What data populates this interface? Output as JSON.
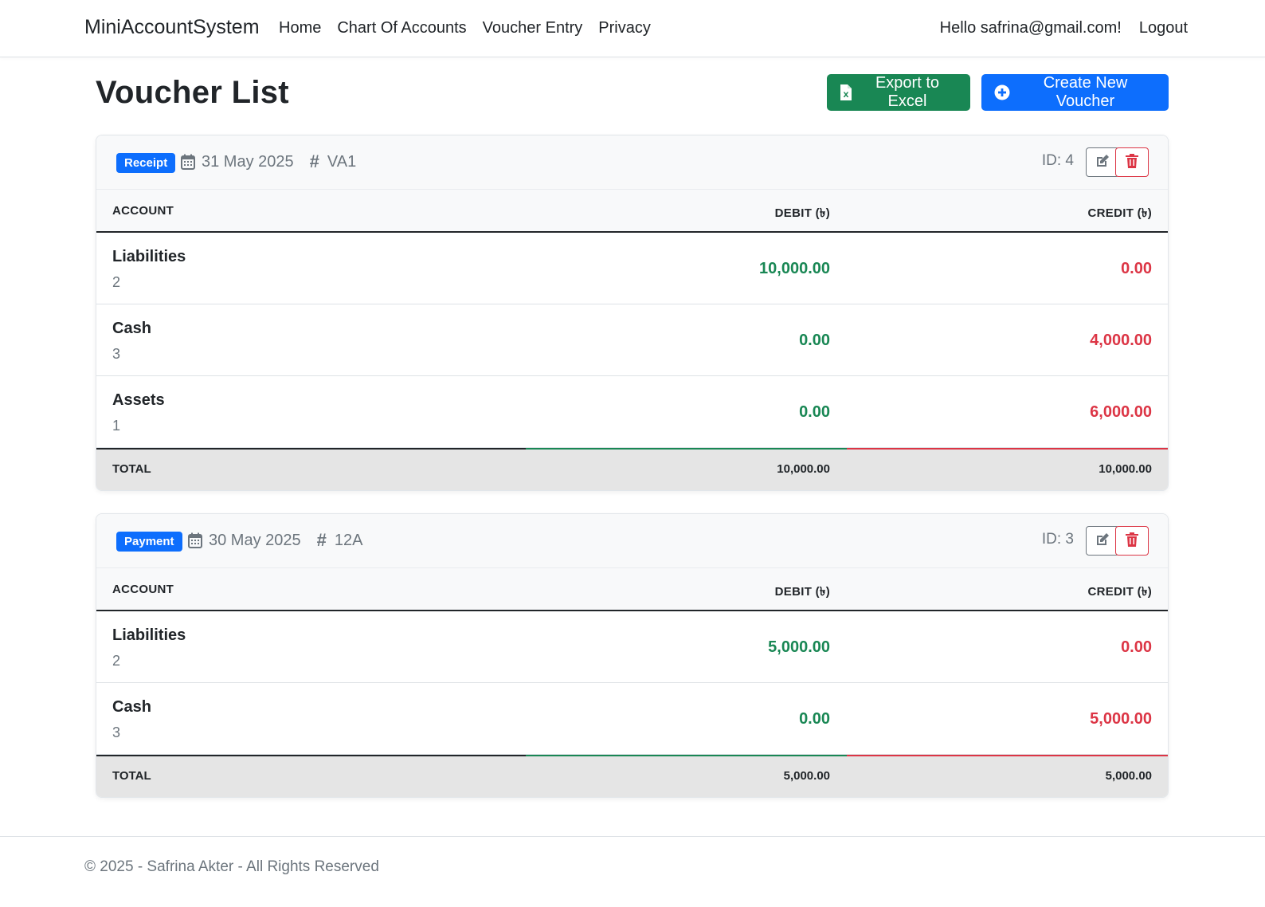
{
  "navbar": {
    "brand": "MiniAccountSystem",
    "links": [
      "Home",
      "Chart Of Accounts",
      "Voucher Entry",
      "Privacy"
    ],
    "greeting": "Hello safrina@gmail.com!",
    "logout": "Logout"
  },
  "page": {
    "title": "Voucher List",
    "export_label": "Export to Excel",
    "create_label": "Create New Voucher"
  },
  "table_headers": {
    "account": "ACCOUNT",
    "debit": "DEBIT (৳)",
    "credit": "CREDIT (৳)"
  },
  "vouchers": [
    {
      "type": "Receipt",
      "date": "31 May 2025",
      "reference": "VA1",
      "id_label": "ID: 4",
      "rows": [
        {
          "account": "Liabilities",
          "code": "2",
          "debit": "10,000.00",
          "credit": "0.00"
        },
        {
          "account": "Cash",
          "code": "3",
          "debit": "0.00",
          "credit": "4,000.00"
        },
        {
          "account": "Assets",
          "code": "1",
          "debit": "0.00",
          "credit": "6,000.00"
        }
      ],
      "total_label": "TOTAL",
      "total_debit": "10,000.00",
      "total_credit": "10,000.00"
    },
    {
      "type": "Payment",
      "date": "30 May 2025",
      "reference": "12A",
      "id_label": "ID: 3",
      "rows": [
        {
          "account": "Liabilities",
          "code": "2",
          "debit": "5,000.00",
          "credit": "0.00"
        },
        {
          "account": "Cash",
          "code": "3",
          "debit": "0.00",
          "credit": "5,000.00"
        }
      ],
      "total_label": "TOTAL",
      "total_debit": "5,000.00",
      "total_credit": "5,000.00"
    }
  ],
  "footer": {
    "text": "© 2025 - Safrina Akter - All Rights Reserved"
  },
  "colors": {
    "primary": "#0d6efd",
    "success": "#198754",
    "danger": "#dc3545",
    "muted": "#6c757d"
  },
  "icons": {
    "export": "file-excel-icon",
    "create": "plus-circle-icon",
    "date": "calendar-icon",
    "reference": "hash-icon",
    "edit": "edit-icon",
    "delete": "trash-icon"
  }
}
